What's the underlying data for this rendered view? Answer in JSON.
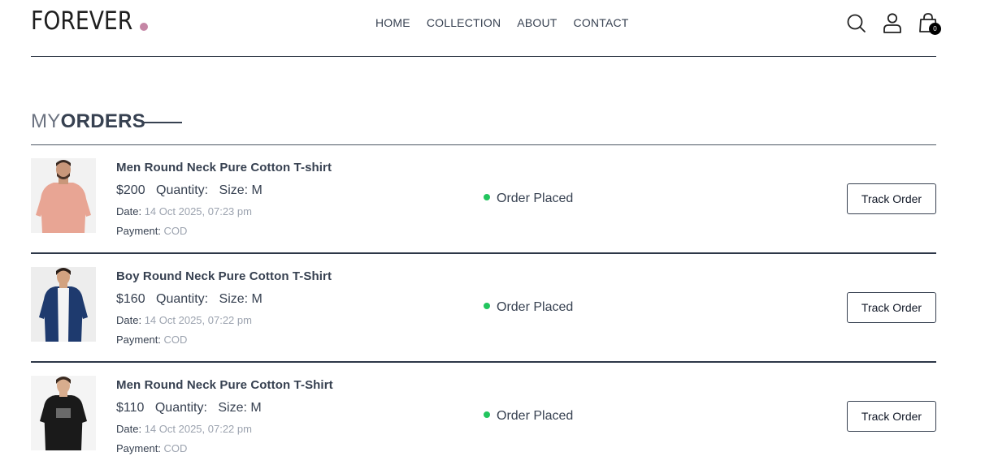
{
  "header": {
    "logo": "FOREVER",
    "nav": [
      "HOME",
      "COLLECTION",
      "ABOUT",
      "CONTACT"
    ],
    "cart_count": "0",
    "icons": [
      "search-icon",
      "profile-icon",
      "cart-icon"
    ]
  },
  "title": {
    "part1": "MY",
    "part2": "ORDERS"
  },
  "orders": [
    {
      "name": "Men Round Neck Pure Cotton T-shirt",
      "price": "$200",
      "quantity": "Quantity:",
      "size": "Size: M",
      "date_label": "Date:",
      "date": "14 Oct 2025, 07:23 pm",
      "payment_label": "Payment:",
      "payment": "COD",
      "status": "Order Placed",
      "button": "Track Order",
      "shirt_color": "#e8a594"
    },
    {
      "name": "Boy Round Neck Pure Cotton T-Shirt",
      "price": "$160",
      "quantity": "Quantity:",
      "size": "Size: M",
      "date_label": "Date:",
      "date": "14 Oct 2025, 07:22 pm",
      "payment_label": "Payment:",
      "payment": "COD",
      "status": "Order Placed",
      "button": "Track Order",
      "shirt_color": "#1e3a6e"
    },
    {
      "name": "Men Round Neck Pure Cotton T-Shirt",
      "price": "$110",
      "quantity": "Quantity:",
      "size": "Size: M",
      "date_label": "Date:",
      "date": "14 Oct 2025, 07:22 pm",
      "payment_label": "Payment:",
      "payment": "COD",
      "status": "Order Placed",
      "button": "Track Order",
      "shirt_color": "#1a1a1a"
    }
  ],
  "colors": {
    "accent_dot": "#c586a5",
    "status_dot": "#22c55e"
  }
}
